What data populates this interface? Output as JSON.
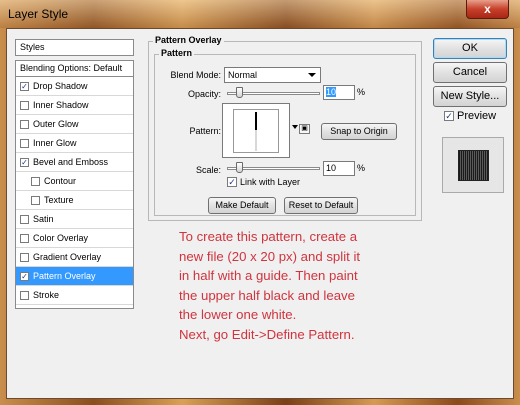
{
  "window": {
    "title": "Layer Style",
    "close_glyph": "x"
  },
  "sidebar": {
    "styles_header": "Styles",
    "blending_header": "Blending Options: Default",
    "items": [
      {
        "label": "Drop Shadow",
        "checked": true,
        "indent": false
      },
      {
        "label": "Inner Shadow",
        "checked": false,
        "indent": false
      },
      {
        "label": "Outer Glow",
        "checked": false,
        "indent": false
      },
      {
        "label": "Inner Glow",
        "checked": false,
        "indent": false
      },
      {
        "label": "Bevel and Emboss",
        "checked": true,
        "indent": false
      },
      {
        "label": "Contour",
        "checked": false,
        "indent": true
      },
      {
        "label": "Texture",
        "checked": false,
        "indent": true
      },
      {
        "label": "Satin",
        "checked": false,
        "indent": false
      },
      {
        "label": "Color Overlay",
        "checked": false,
        "indent": false
      },
      {
        "label": "Gradient Overlay",
        "checked": false,
        "indent": false
      },
      {
        "label": "Pattern Overlay",
        "checked": true,
        "indent": false,
        "selected": true
      },
      {
        "label": "Stroke",
        "checked": false,
        "indent": false
      }
    ]
  },
  "panel": {
    "outer_title": "Pattern Overlay",
    "inner_title": "Pattern",
    "blend_mode_label": "Blend Mode:",
    "blend_mode_value": "Normal",
    "opacity_label": "Opacity:",
    "opacity_value": "10",
    "opacity_unit": "%",
    "pattern_label": "Pattern:",
    "new_preset_glyph": "▣",
    "snap_button": "Snap to Origin",
    "scale_label": "Scale:",
    "scale_value": "10",
    "scale_unit": "%",
    "link_label": "Link with Layer",
    "link_checked": true,
    "make_default_button": "Make Default",
    "reset_default_button": "Reset to Default"
  },
  "right": {
    "ok_button": "OK",
    "cancel_button": "Cancel",
    "new_style_button": "New Style...",
    "preview_label": "Preview",
    "preview_checked": true
  },
  "note_lines": [
    "To create this pattern, create a",
    "new file (20 x 20 px) and split it",
    "in half with a guide. Then paint",
    "the upper half black and leave",
    "the lower one white.",
    "Next, go Edit->Define Pattern."
  ],
  "colors": {
    "note": "#d0343e",
    "selection": "#3399ff",
    "close": "#c7402a"
  },
  "icons": {
    "check": "✓"
  }
}
